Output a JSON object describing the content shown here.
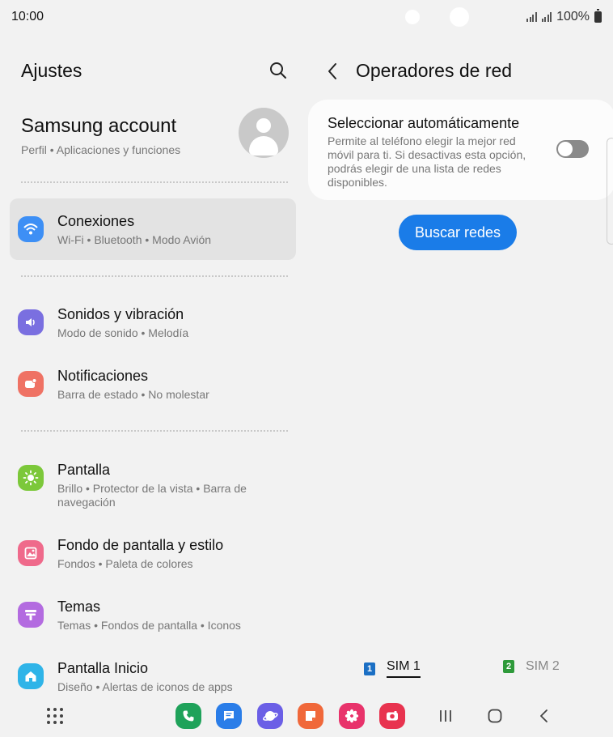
{
  "status_bar": {
    "time": "10:00",
    "battery": "100%"
  },
  "settings": {
    "title": "Ajustes",
    "account": {
      "name": "Samsung account",
      "subtitle": "Perfil  •  Aplicaciones y funciones"
    },
    "items": [
      {
        "title": "Conexiones",
        "desc": "Wi-Fi  •  Bluetooth  •  Modo Avión",
        "icon": "wifi-icon",
        "color": "#3d8ff5"
      },
      {
        "title": "Sonidos y vibración",
        "desc": "Modo de sonido  •  Melodía",
        "icon": "volume-icon",
        "color": "#7a6fe0"
      },
      {
        "title": "Notificaciones",
        "desc": "Barra de estado  •  No molestar",
        "icon": "notification-icon",
        "color": "#ef7264"
      },
      {
        "title": "Pantalla",
        "desc": "Brillo  •  Protector de la vista  •  Barra de navegación",
        "icon": "brightness-icon",
        "color": "#7cc83a"
      },
      {
        "title": "Fondo de pantalla y estilo",
        "desc": "Fondos  •  Paleta de colores",
        "icon": "wallpaper-icon",
        "color": "#ef6a8b"
      },
      {
        "title": "Temas",
        "desc": "Temas  •  Fondos de pantalla  •  Iconos",
        "icon": "themes-icon",
        "color": "#b36be0"
      },
      {
        "title": "Pantalla Inicio",
        "desc": "Diseño  •  Alertas de iconos de apps",
        "icon": "home-icon",
        "color": "#2fb4e8"
      }
    ]
  },
  "network": {
    "title": "Operadores de red",
    "auto_select_title": "Seleccionar automáticamente",
    "auto_select_desc": "Permite al teléfono elegir la mejor red móvil para ti. Si desactivas esta opción, podrás elegir de una lista de redes disponibles.",
    "auto_select_enabled": false,
    "search_button": "Buscar redes",
    "sim_tabs": [
      {
        "badge": "1",
        "label": "SIM 1",
        "color": "#1b6fc4",
        "selected": true
      },
      {
        "badge": "2",
        "label": "SIM 2",
        "color": "#2e9a3a",
        "selected": false
      }
    ]
  },
  "dock": {
    "apps": [
      {
        "icon": "phone-icon",
        "color": "#1fa25a"
      },
      {
        "icon": "messages-icon",
        "color": "#2a7de8"
      },
      {
        "icon": "internet-icon",
        "color": "#6b5fe6"
      },
      {
        "icon": "notes-icon",
        "color": "#f0683a"
      },
      {
        "icon": "gallery-icon",
        "color": "#e8336b"
      },
      {
        "icon": "camera-icon",
        "color": "#e8334f"
      }
    ]
  }
}
